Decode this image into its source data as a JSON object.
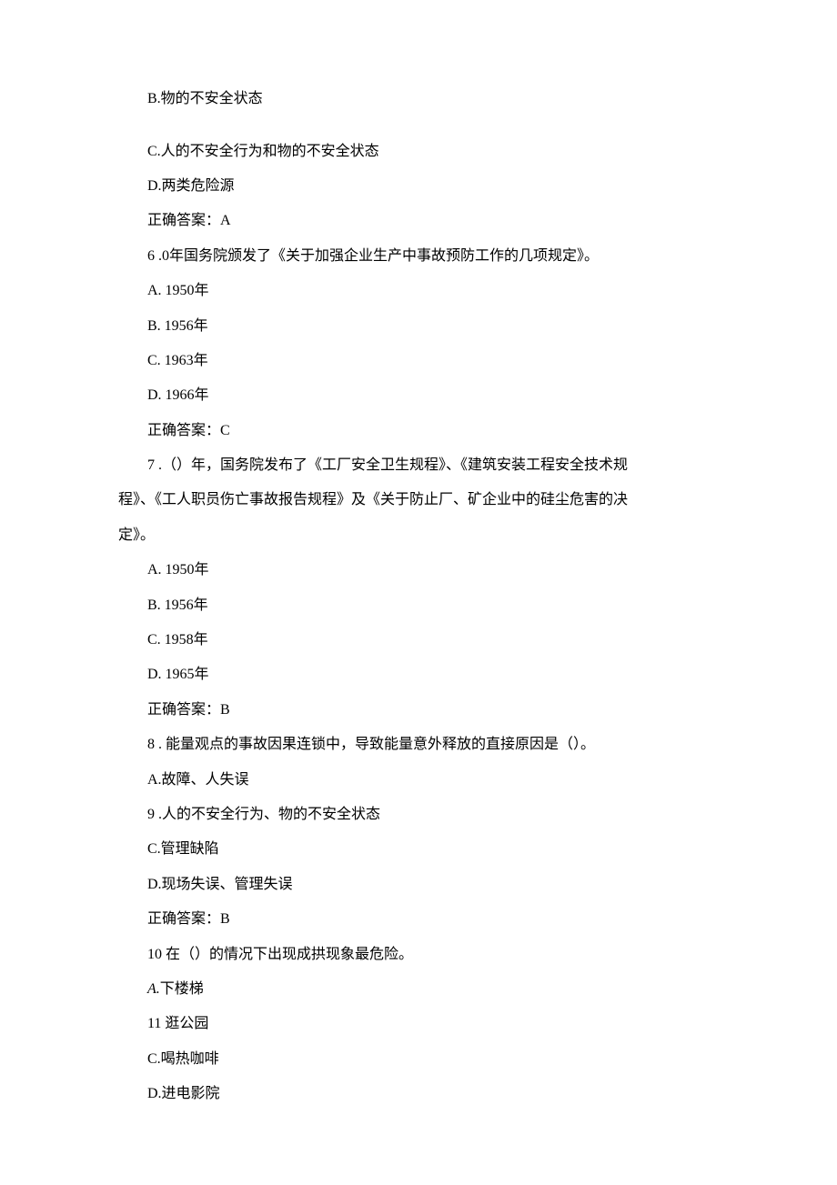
{
  "lines": [
    {
      "text": "B.物的不安全状态",
      "indent": true,
      "blankAfter": true
    },
    {
      "text": "C.人的不安全行为和物的不安全状态",
      "indent": true
    },
    {
      "text": "D.两类危险源",
      "indent": true
    },
    {
      "text": "正确答案：A",
      "indent": true
    },
    {
      "text": "6 .0年国务院颁发了《关于加强企业生产中事故预防工作的几项规定》。",
      "indent": true
    },
    {
      "text": "A. 1950年",
      "indent": true
    },
    {
      "text": "B. 1956年",
      "indent": true
    },
    {
      "text": "C. 1963年",
      "indent": true
    },
    {
      "text": "D. 1966年",
      "indent": true
    },
    {
      "text": "正确答案：C",
      "indent": true
    },
    {
      "text": "7 .（）年，国务院发布了《工厂安全卫生规程》、《建筑安装工程安全技术规",
      "indent": true,
      "noIndent": false
    },
    {
      "text": "程》、《工人职员伤亡事故报告规程》及《关于防止厂、矿企业中的硅尘危害的决",
      "indent": false
    },
    {
      "text": "定》。",
      "indent": false
    },
    {
      "text": "A. 1950年",
      "indent": true
    },
    {
      "text": "B. 1956年",
      "indent": true
    },
    {
      "text": "C. 1958年",
      "indent": true
    },
    {
      "text": "D. 1965年",
      "indent": true
    },
    {
      "text": "正确答案：B",
      "indent": true
    },
    {
      "text": "8 . 能量观点的事故因果连锁中，导致能量意外释放的直接原因是（）。",
      "indent": true
    },
    {
      "text": "A.故障、人失误",
      "indent": true
    },
    {
      "text": "9 .人的不安全行为、物的不安全状态",
      "indent": true
    },
    {
      "text": "C.管理缺陷",
      "indent": true
    },
    {
      "text": "D.现场失误、管理失误",
      "indent": true
    },
    {
      "text": "正确答案：B",
      "indent": true
    },
    {
      "text": "10 在（）的情况下出现成拱现象最危险。",
      "indent": true
    },
    {
      "text": "A.下楼梯",
      "indent": true,
      "italicPrefix": "A."
    },
    {
      "text": "11 逛公园",
      "indent": true
    },
    {
      "text": "C.喝热咖啡",
      "indent": true
    },
    {
      "text": "D.进电影院",
      "indent": true
    }
  ]
}
